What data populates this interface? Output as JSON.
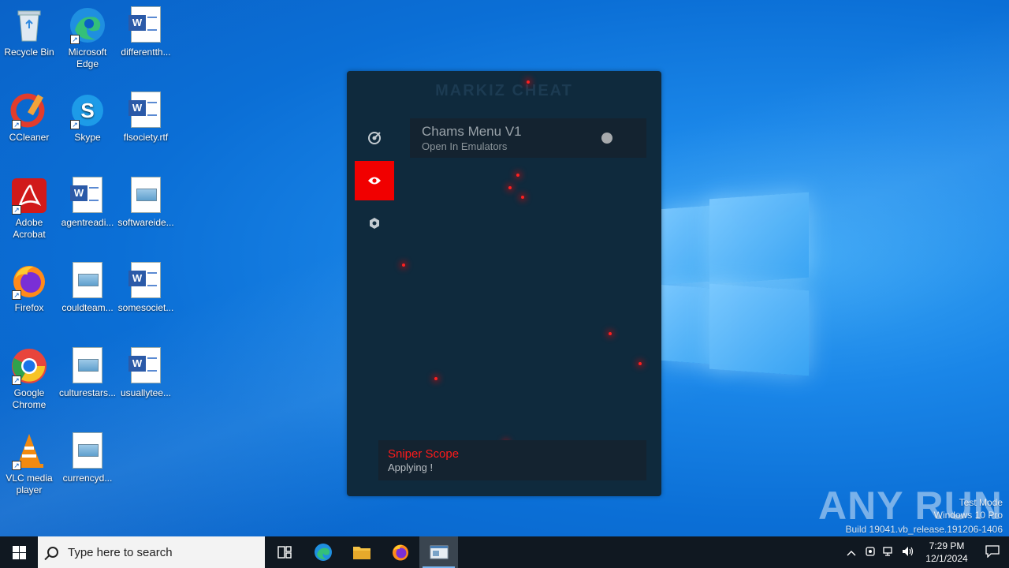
{
  "desktop": {
    "icons": [
      {
        "label": "Recycle Bin"
      },
      {
        "label": "Microsoft Edge"
      },
      {
        "label": "differentth..."
      },
      {
        "label": "CCleaner"
      },
      {
        "label": "Skype"
      },
      {
        "label": "flsociety.rtf"
      },
      {
        "label": "Adobe Acrobat"
      },
      {
        "label": "agentreadi..."
      },
      {
        "label": "softwareide..."
      },
      {
        "label": "Firefox"
      },
      {
        "label": "couldteam..."
      },
      {
        "label": "somesociet..."
      },
      {
        "label": "Google Chrome"
      },
      {
        "label": "culturestars..."
      },
      {
        "label": "usuallytee..."
      },
      {
        "label": "VLC media player"
      },
      {
        "label": "currencyd..."
      }
    ]
  },
  "cheat_window": {
    "title": "MARKIZ CHEAT",
    "sidebar": [
      "aim-icon",
      "eye-icon",
      "gear-icon"
    ],
    "module": {
      "name": "Chams Menu V1",
      "description": "Open In Emulators",
      "enabled": false
    },
    "notification": {
      "title": "Sniper Scope",
      "status": "Applying !"
    },
    "accent_color": "#f10000"
  },
  "watermark": {
    "brand": "ANY RUN",
    "mode": "Test Mode",
    "os": "Windows 10 Pro",
    "build": "Build 19041.vb_release.191206-1406"
  },
  "taskbar": {
    "search_placeholder": "Type here to search",
    "apps": [
      "task-view-icon",
      "edge-icon",
      "file-explorer-icon",
      "firefox-icon",
      "cheat-app-icon"
    ],
    "time": "7:29 PM",
    "date": "12/1/2024"
  }
}
